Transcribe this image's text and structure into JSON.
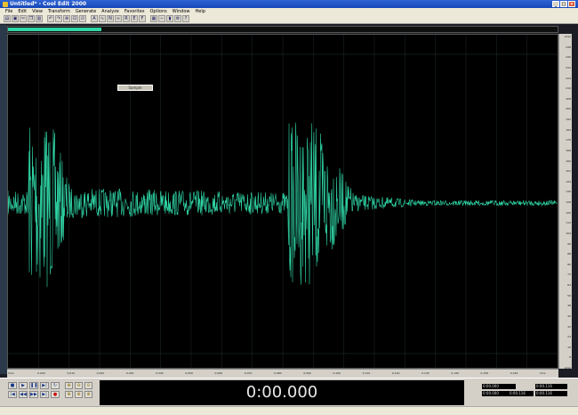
{
  "window": {
    "title": "Untitled* - Cool Edit 2000"
  },
  "menu": [
    "File",
    "Edit",
    "View",
    "Transform",
    "Generate",
    "Analyze",
    "Favorites",
    "Options",
    "Window",
    "Help"
  ],
  "tooltip": "Sample",
  "colors": {
    "waveform": "#2fd5a5",
    "background": "#000000",
    "grid": "#1e2a2a"
  },
  "ruler_labels": [
    "smpl",
    "248",
    "240",
    "232",
    "224",
    "216",
    "208",
    "200",
    "192",
    "184",
    "176",
    "168",
    "160",
    "152",
    "144",
    "136",
    "128",
    "120",
    "112",
    "104",
    "96",
    "88",
    "80",
    "72",
    "64",
    "56",
    "48",
    "40",
    "32",
    "24",
    "16",
    "8",
    "smpl"
  ],
  "time_labels": [
    "hms",
    "0.000",
    "0.010",
    "0.020",
    "0.030",
    "0.040",
    "0.050",
    "0.060",
    "0.070",
    "0.080",
    "0.090",
    "0.100",
    "0.110",
    "0.120",
    "0.130",
    "0.140",
    "0.150",
    "0.160",
    "hms"
  ],
  "time_display": "0:00.000",
  "selection": {
    "begin": "0:00.000",
    "end": "0:00.116",
    "length": "0:00.116",
    "view_begin": "0:00.000",
    "view_end": "0:00.116",
    "view_length": "0:00.116"
  },
  "overview_fraction": 0.17
}
